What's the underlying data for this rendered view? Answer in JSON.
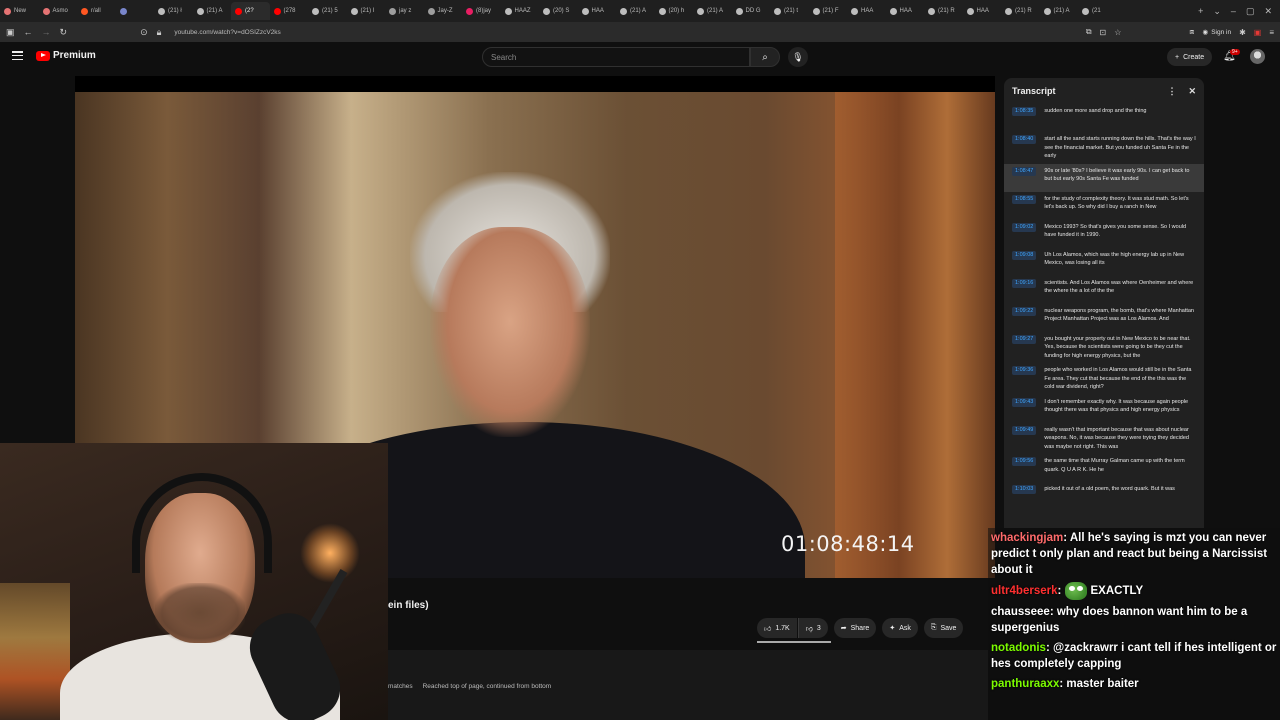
{
  "browser": {
    "tabs": [
      {
        "label": "New",
        "fav": "#e57373"
      },
      {
        "label": "Asmo",
        "fav": "#e57373"
      },
      {
        "label": "r/all",
        "fav": "#ff5722"
      },
      {
        "label": "",
        "fav": "#7986cb"
      },
      {
        "label": "(21) ł",
        "fav": "#bdbdbd"
      },
      {
        "label": "(21) A",
        "fav": "#bdbdbd"
      },
      {
        "label": "(2?",
        "fav": "#ff0000"
      },
      {
        "label": "(278",
        "fav": "#ff0000"
      },
      {
        "label": "(21) 5",
        "fav": "#bdbdbd"
      },
      {
        "label": "(21) I",
        "fav": "#bdbdbd"
      },
      {
        "label": "jay z",
        "fav": "#9e9e9e"
      },
      {
        "label": "Jay-Z",
        "fav": "#9e9e9e"
      },
      {
        "label": "(8)jay",
        "fav": "#e91e63"
      },
      {
        "label": "HAAZ",
        "fav": "#bdbdbd"
      },
      {
        "label": "(20) S",
        "fav": "#bdbdbd"
      },
      {
        "label": "HAA",
        "fav": "#bdbdbd"
      },
      {
        "label": "(21) A",
        "fav": "#bdbdbd"
      },
      {
        "label": "(20) h",
        "fav": "#bdbdbd"
      },
      {
        "label": "(21) A",
        "fav": "#bdbdbd"
      },
      {
        "label": "DD G",
        "fav": "#bdbdbd"
      },
      {
        "label": "(21) t",
        "fav": "#bdbdbd"
      },
      {
        "label": "(21) F",
        "fav": "#bdbdbd"
      },
      {
        "label": "HAA",
        "fav": "#bdbdbd"
      },
      {
        "label": "HAA",
        "fav": "#bdbdbd"
      },
      {
        "label": "(21) R",
        "fav": "#bdbdbd"
      },
      {
        "label": "HAA",
        "fav": "#bdbdbd"
      },
      {
        "label": "(21) R",
        "fav": "#bdbdbd"
      },
      {
        "label": "(21) A",
        "fav": "#bdbdbd"
      },
      {
        "label": "(21",
        "fav": "#bdbdbd"
      }
    ],
    "active_tab_index": 6,
    "url": "youtube.com/watch?v=dOSIZzcV2ks",
    "signin_label": "Sign in"
  },
  "header": {
    "brand": "Premium",
    "search_placeholder": "Search",
    "create_label": "Create",
    "notif_count": "9+"
  },
  "video": {
    "timecode": "01:08:48:14",
    "title_fragment": "ein files)"
  },
  "actions": {
    "likes": "1.7K",
    "dislikes": "3",
    "share": "Share",
    "ask": "Ask",
    "save": "Save"
  },
  "findbar": {
    "matches": "matches",
    "status": "Reached top of page, continued from bottom"
  },
  "transcript": {
    "title": "Transcript",
    "rows": [
      {
        "time": "1:08:35",
        "text": "sudden one more sand drop and the thing"
      },
      {
        "time": "1:08:40",
        "text": "start all the sand starts running down the hills. That's the way I see the financial market. But you funded uh Santa Fe in the early"
      },
      {
        "time": "1:08:47",
        "text": "90s or late '80s? I believe it was early 90s. I can get back to but but early 90s Santa Fe was funded"
      },
      {
        "time": "1:08:55",
        "text": "for the study of complexity theory. It was stud math. So let's let's back up. So why did I buy a ranch in New"
      },
      {
        "time": "1:09:02",
        "text": "Mexico 1993? So that's gives you some sense. So I would have funded it in 1990."
      },
      {
        "time": "1:09:08",
        "text": "Uh Los Alamos, which was the high energy lab up in New Mexico, was losing all its"
      },
      {
        "time": "1:09:16",
        "text": "scientists. And Los Alamos was where Oenheimer and where the where the a lot of the the"
      },
      {
        "time": "1:09:22",
        "text": "nuclear weapons program, the bomb, that's where Manhattan Project Manhattan Project was as Los Alamos. And"
      },
      {
        "time": "1:09:27",
        "text": "you bought your property out in New Mexico to be near that. Yes, because the scientists were going to be they cut the funding for high energy physics, but the"
      },
      {
        "time": "1:09:36",
        "text": "people who worked in Los Alamos would still be in the Santa Fe area. They cut that because the end of the this was the cold war dividend, right?"
      },
      {
        "time": "1:09:43",
        "text": "I don't remember exactly why. It was because again people thought there was that physics and high energy physics"
      },
      {
        "time": "1:09:49",
        "text": "really wasn't that important because that was about nuclear weapons. No, it was because they were trying they decided was maybe not right. This was"
      },
      {
        "time": "1:09:56",
        "text": "the same time that Murray Galman came up with the term quark. Q U A R K. He he"
      },
      {
        "time": "1:10:03",
        "text": "picked it out of a old poem, the word quark. But it was"
      }
    ],
    "highlight_index": 2
  },
  "chat": {
    "messages": [
      {
        "user": "whackingjam",
        "color": "#ff6b6b",
        "text": "All he's saying is mzt you can never predict t only plan and react but being a Narcissist about it",
        "emote": false
      },
      {
        "user": "ultr4berserk",
        "color": "#ff3030",
        "text": "EXACTLY",
        "emote": true
      },
      {
        "user": "chausseee",
        "color": "#ffffff",
        "text": "why does bannon want him to be a supergenius",
        "emote": false
      },
      {
        "user": "notadonis",
        "color": "#7cfc00",
        "text": "@zackrawrr i cant tell if hes intelligent or hes completely capping",
        "emote": false
      },
      {
        "user": "panthuraaxx",
        "color": "#7cfc00",
        "text": "master baiter",
        "emote": false
      }
    ]
  }
}
